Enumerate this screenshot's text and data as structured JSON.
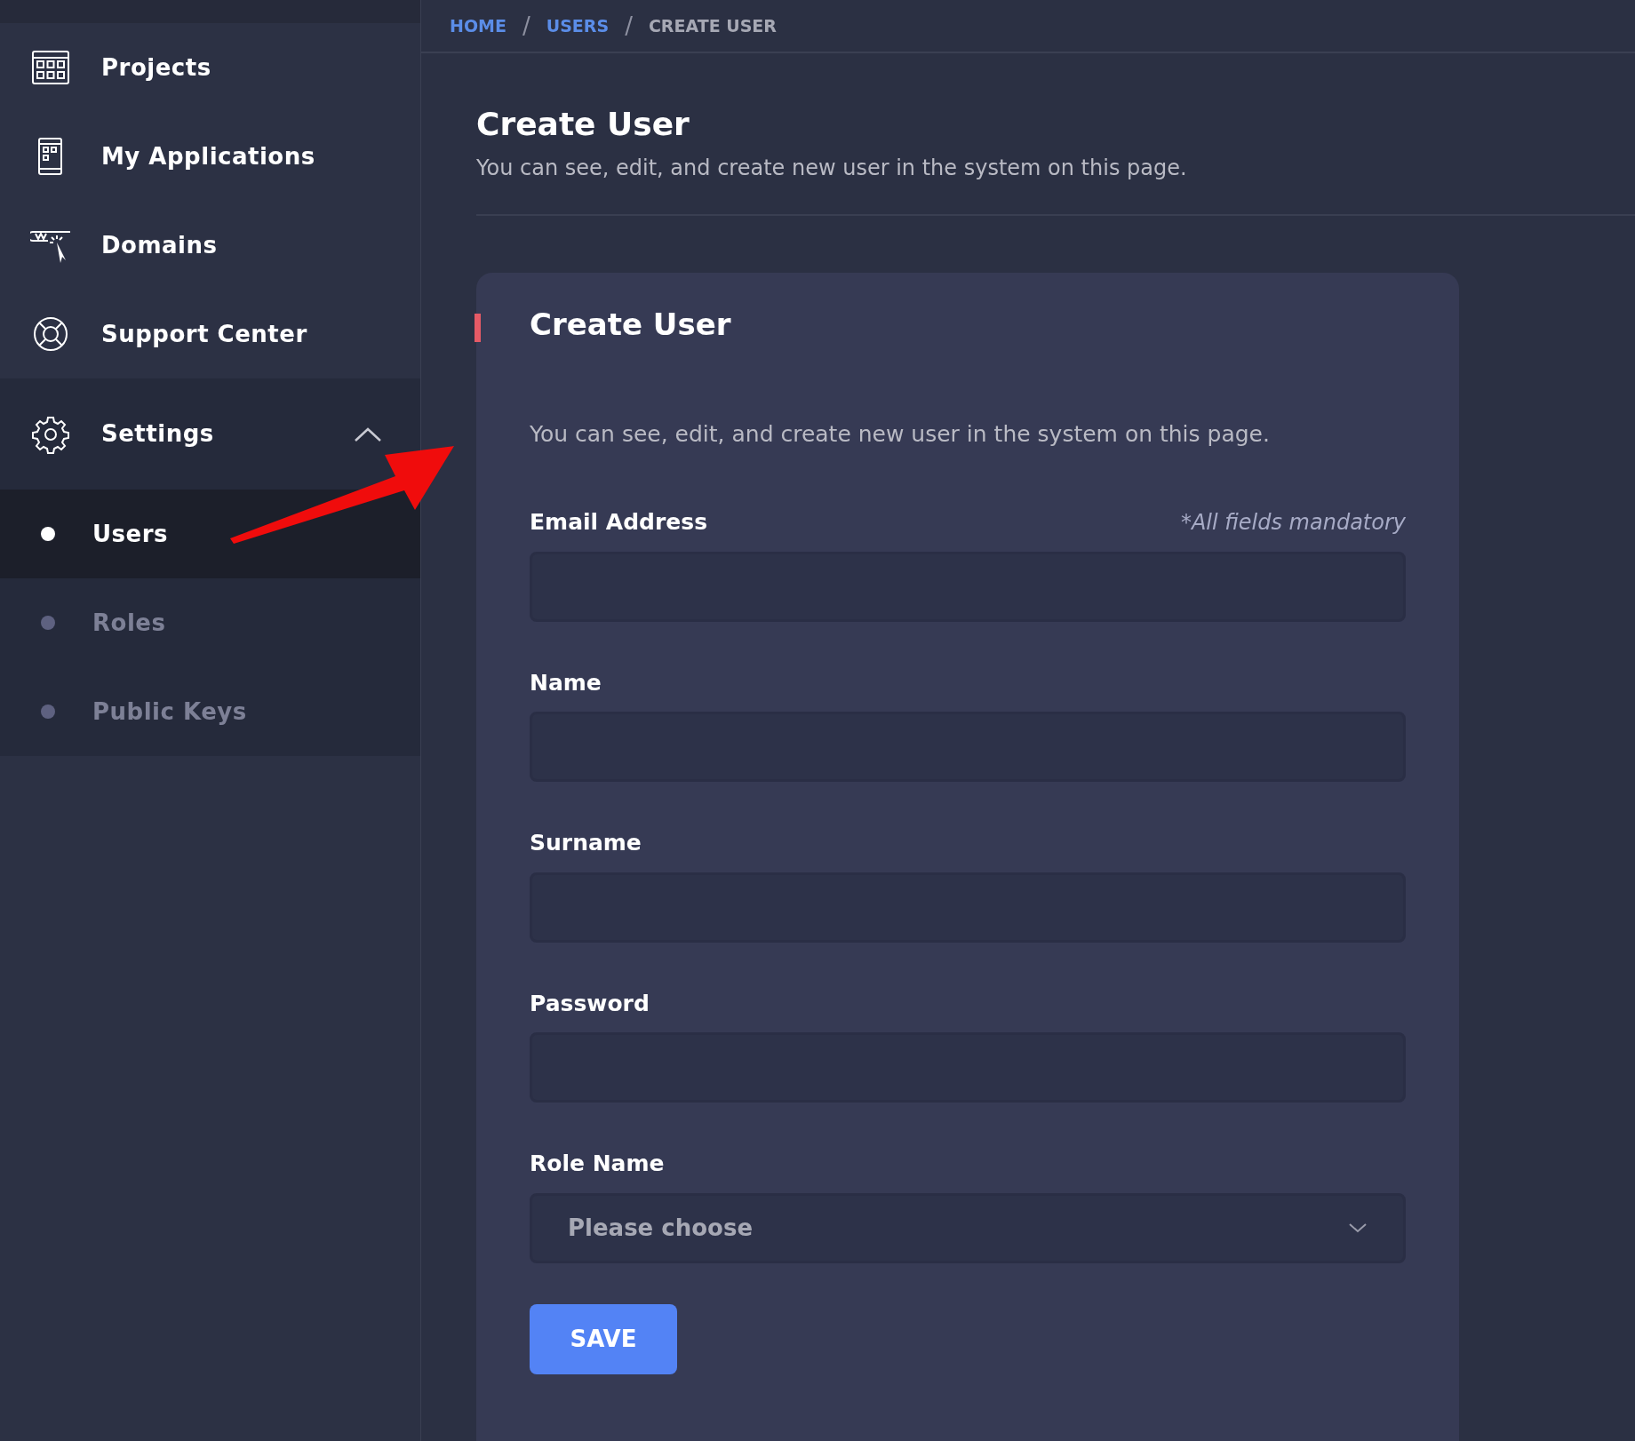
{
  "sidebar": {
    "items": [
      {
        "label": "Projects"
      },
      {
        "label": "My Applications"
      },
      {
        "label": "Domains"
      },
      {
        "label": "Support Center"
      },
      {
        "label": "Settings",
        "expanded": true,
        "children": [
          {
            "label": "Users",
            "selected": true
          },
          {
            "label": "Roles",
            "selected": false
          },
          {
            "label": "Public Keys",
            "selected": false
          }
        ]
      }
    ]
  },
  "breadcrumb": [
    {
      "kind": "link",
      "label": "HOME"
    },
    {
      "kind": "separator",
      "label": "/"
    },
    {
      "kind": "link",
      "label": "USERS"
    },
    {
      "kind": "separator",
      "label": "/"
    },
    {
      "kind": "current",
      "label": "CREATE USER"
    }
  ],
  "page": {
    "title": "Create User",
    "subtitle": "You can see, edit, and create new user in the system on this page."
  },
  "form": {
    "title": "Create User",
    "description": "You can see, edit, and create new user in the system on this page.",
    "note": "*All fields mandatory",
    "fields": [
      {
        "label": "Email Address",
        "kind": "text"
      },
      {
        "label": "Name",
        "kind": "text"
      },
      {
        "label": "Surname",
        "kind": "text"
      },
      {
        "label": "Password",
        "kind": "password"
      },
      {
        "label": "Role Name",
        "kind": "select",
        "placeholder": "Please choose"
      }
    ],
    "submit": "SAVE"
  }
}
